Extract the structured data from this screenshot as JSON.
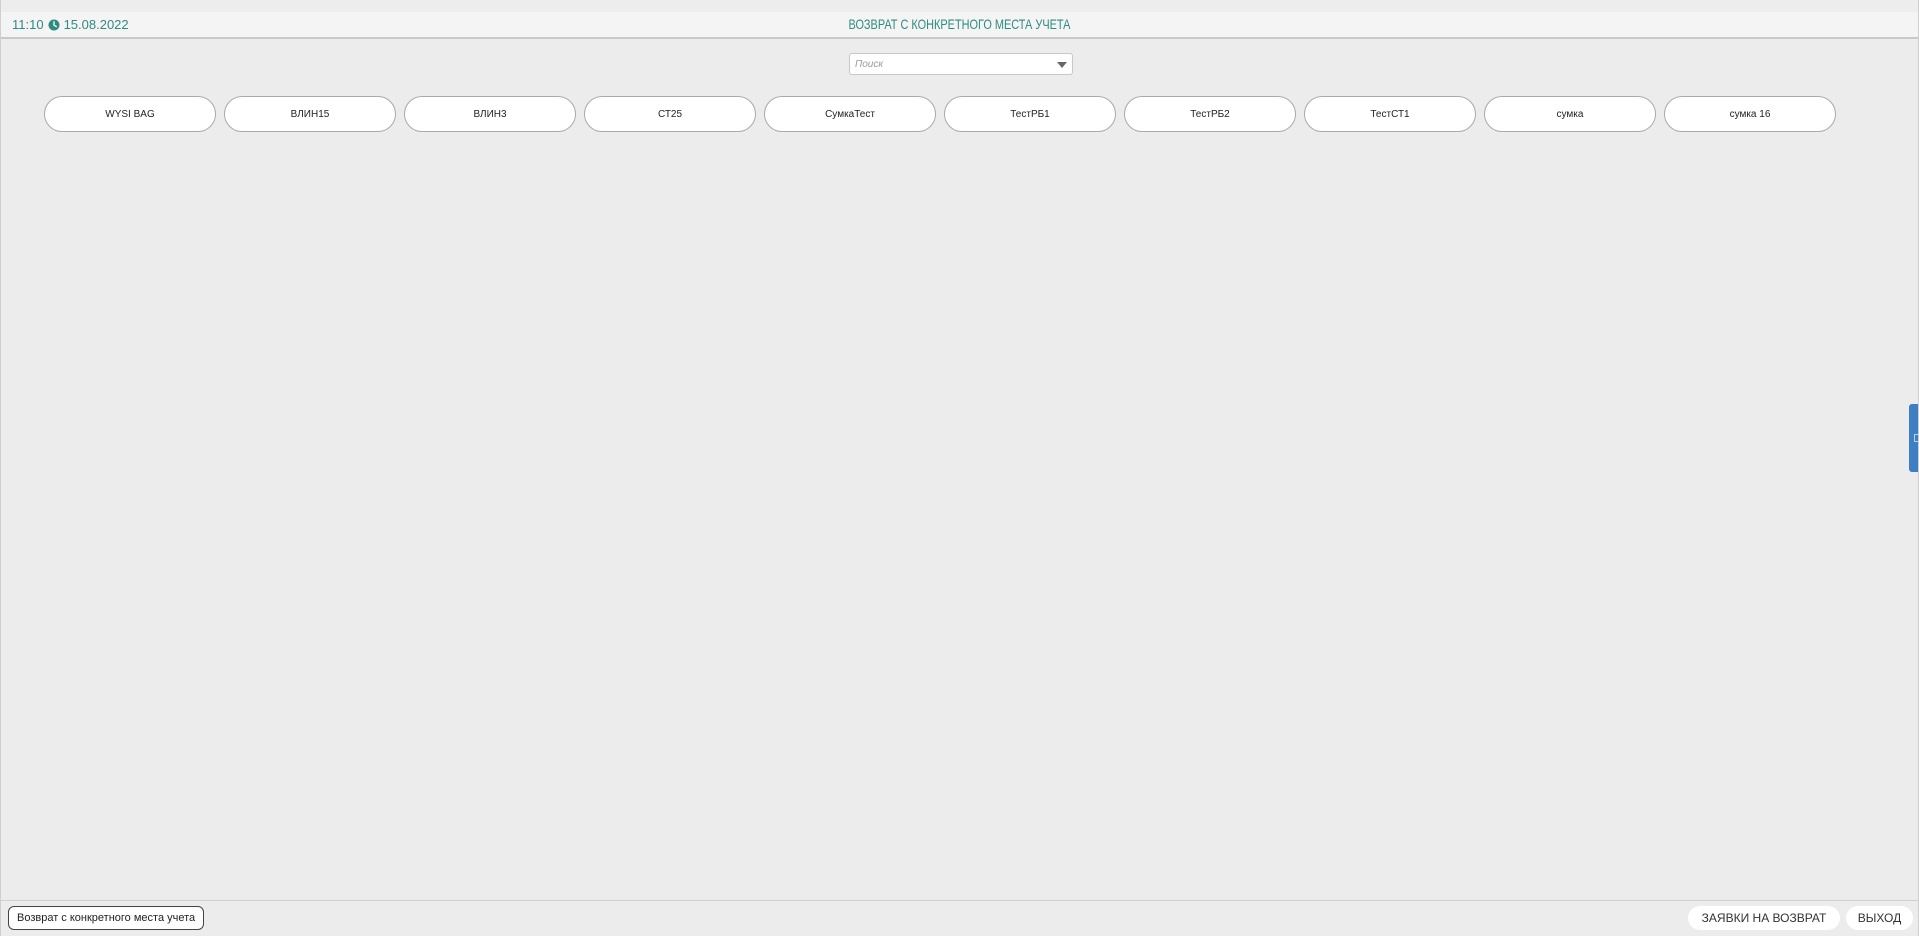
{
  "header": {
    "time": "11:10",
    "date": "15.08.2022",
    "title": "ВОЗВРАТ С КОНКРЕТНОГО МЕСТА УЧЕТА",
    "accent_color": "#2e8b80",
    "clock_icon": "clock-icon"
  },
  "search": {
    "placeholder": "Поиск",
    "value": "",
    "dropdown_icon": "chevron-down-icon"
  },
  "places": [
    {
      "label": "WYSI BAG"
    },
    {
      "label": "ВЛИН15"
    },
    {
      "label": "ВЛИН3"
    },
    {
      "label": "СТ25"
    },
    {
      "label": "СумкаТест"
    },
    {
      "label": "ТестРБ1"
    },
    {
      "label": "ТестРБ2"
    },
    {
      "label": "ТестСТ1"
    },
    {
      "label": "сумка"
    },
    {
      "label": "сумка 16"
    }
  ],
  "side_panel": {
    "color": "#3d7fc1",
    "icon": "panel-collapse-icon"
  },
  "footer": {
    "breadcrumb": "Возврат с конкретного места учета",
    "requests_label": "ЗАЯВКИ НА ВОЗВРАТ",
    "exit_label": "ВЫХОД"
  }
}
